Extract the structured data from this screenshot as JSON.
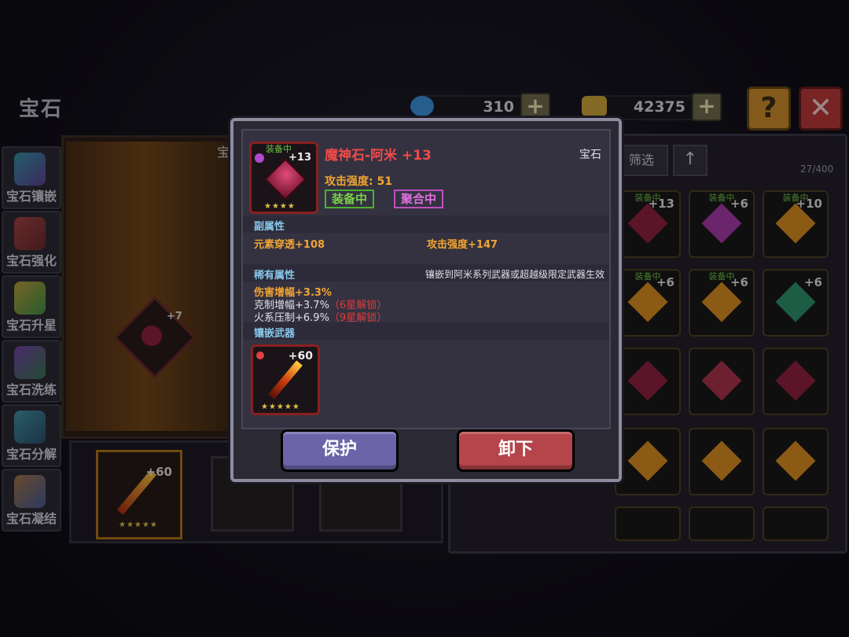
{
  "page_title": "宝石",
  "currency": [
    {
      "name": "gem",
      "value": "310",
      "color": "#3a8fd9"
    },
    {
      "name": "gold",
      "value": "42375",
      "color": "#c9a43a"
    }
  ],
  "header_buttons": {
    "help": "?",
    "close": "✕"
  },
  "sidebar": {
    "items": [
      {
        "label": "宝石镶嵌"
      },
      {
        "label": "宝石强化"
      },
      {
        "label": "宝石升星"
      },
      {
        "label": "宝石洗练"
      },
      {
        "label": "宝石分解"
      },
      {
        "label": "宝石凝结"
      }
    ]
  },
  "background": {
    "partial_label": "宝",
    "socket_level": "+7",
    "filter_label": "筛选",
    "capacity": "27/400",
    "bottom_weapon_level": "+60",
    "grid_labels": {
      "equipped": "装备中"
    }
  },
  "grid": [
    {
      "equipped": true,
      "level": "+13",
      "color": "#8e1f3f"
    },
    {
      "equipped": true,
      "level": "+6",
      "color": "#a33aa6"
    },
    {
      "equipped": true,
      "level": "+10",
      "color": "#d68a1f"
    },
    {
      "equipped": true,
      "level": "+6",
      "color": "#d68a1f"
    },
    {
      "equipped": true,
      "level": "+6",
      "color": "#d68a1f"
    },
    {
      "equipped": false,
      "level": "+6",
      "color": "#2f8f6a"
    },
    {
      "equipped": false,
      "level": "",
      "color": "#8e1f3f"
    },
    {
      "equipped": false,
      "level": "",
      "color": "#a8324a"
    },
    {
      "equipped": false,
      "level": "",
      "color": "#8e1f3f"
    },
    {
      "equipped": false,
      "level": "",
      "color": "#d68a1f"
    },
    {
      "equipped": false,
      "level": "",
      "color": "#d68a1f"
    },
    {
      "equipped": false,
      "level": "",
      "color": "#d68a1f"
    }
  ],
  "modal": {
    "item": {
      "name": "魔神石-阿米 +13",
      "category": "宝石",
      "equipped_badge": "装备中",
      "level": "+13",
      "attack_label": "攻击强度: 51",
      "tags": [
        "装备中",
        "聚合中"
      ],
      "stars": "★★★★"
    },
    "sub_attr": {
      "title": "副属性",
      "items": [
        "元素穿透+108",
        "攻击强度+147"
      ]
    },
    "rare_attr": {
      "title": "稀有属性",
      "note": "镶嵌到阿米系列武器或超越级限定武器生效",
      "line1": "伤害增幅+3.3%",
      "line2": "克制增幅+3.7%",
      "line2_lock": "（6星解锁）",
      "line3": "火系压制+6.9%",
      "line3_lock": "（9星解锁）"
    },
    "weapon": {
      "title": "镶嵌武器",
      "level": "+60",
      "stars": "★★★★★"
    },
    "buttons": {
      "protect": "保护",
      "unequip": "卸下"
    }
  }
}
